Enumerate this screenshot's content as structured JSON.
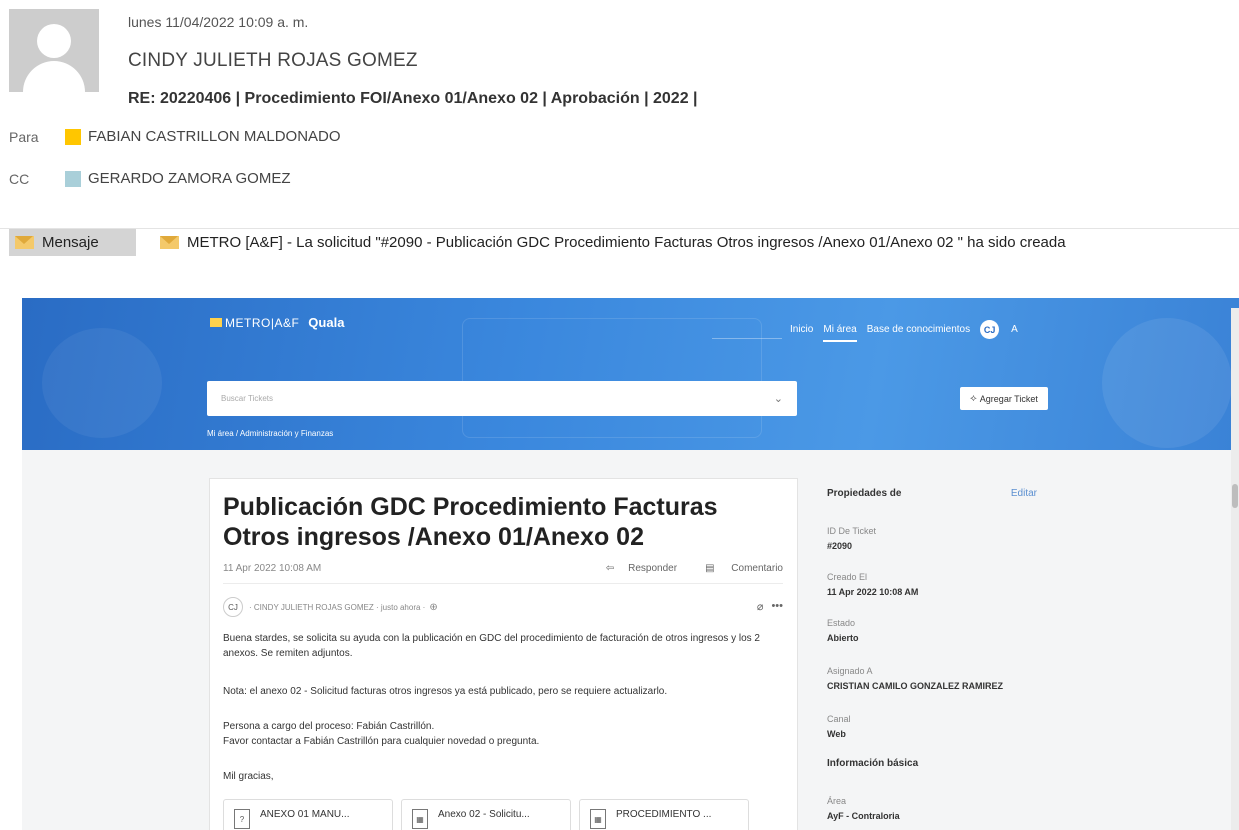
{
  "email": {
    "date": "lunes 11/04/2022 10:09 a. m.",
    "sender": "CINDY JULIETH ROJAS GOMEZ",
    "subject": "RE: 20220406 | Procedimiento FOI/Anexo 01/Anexo 02 | Aprobación | 2022 |",
    "to_label": "Para",
    "to_name": "FABIAN CASTRILLON MALDONADO",
    "to_color": "#ffc600",
    "cc_label": "CC",
    "cc_name": "GERARDO ZAMORA GOMEZ",
    "cc_color": "#a9cfd9",
    "message_tab": "Mensaje",
    "attachment_title": "METRO [A&F] - La solicitud \"#2090 - Publicación GDC Procedimiento Facturas Otros ingresos /Anexo 01/Anexo 02 \" ha sido creada"
  },
  "portal": {
    "logo_text": "METRO|A&F",
    "brand": "Quala",
    "nav": [
      "Inicio",
      "Mi área",
      "Base de conocimientos"
    ],
    "user_initials": "CJ",
    "nav_extra": "A",
    "search_placeholder": "Buscar Tickets",
    "add_ticket": "Agregar Ticket",
    "breadcrumb": "Mi área  /  Administración y Finanzas"
  },
  "ticket": {
    "title": "Publicación GDC Procedimiento Facturas Otros ingresos /Anexo 01/Anexo 02",
    "date": "11 Apr 2022 10:08 AM",
    "reply": "Responder",
    "comment": "Comentario",
    "author_initials": "CJ",
    "author_meta": "·  CINDY JULIETH ROJAS GOMEZ  ·  justo ahora  ·",
    "body": [
      "Buena stardes,  se solicita su ayuda con la publicación en GDC del procedimiento de facturación de otros ingresos y los 2 anexos. Se remiten adjuntos.",
      "Nota: el anexo 02 - Solicitud facturas otros ingresos ya está publicado, pero se requiere actualizarlo.",
      "Persona a cargo del proceso: Fabián Castrillón.",
      "Favor contactar a Fabián Castrillón para cualquier novedad o pregunta.",
      "Mil gracias,"
    ],
    "files": [
      "ANEXO 01 MANU...",
      "Anexo 02 - Solicitu...",
      "PROCEDIMIENTO ..."
    ]
  },
  "properties": {
    "header": "Propiedades de",
    "edit": "Editar",
    "items": [
      {
        "key": "ID De Ticket",
        "value": "#2090"
      },
      {
        "key": "Creado El",
        "value": "11 Apr 2022 10:08 AM"
      },
      {
        "key": "Estado",
        "value": "Abierto"
      },
      {
        "key": "Asignado A",
        "value": "CRISTIAN CAMILO GONZALEZ RAMIREZ"
      },
      {
        "key": "Canal",
        "value": "Web"
      }
    ],
    "section": "Información básica",
    "area_key": "Área",
    "area_value": "AyF - Contraloria"
  }
}
